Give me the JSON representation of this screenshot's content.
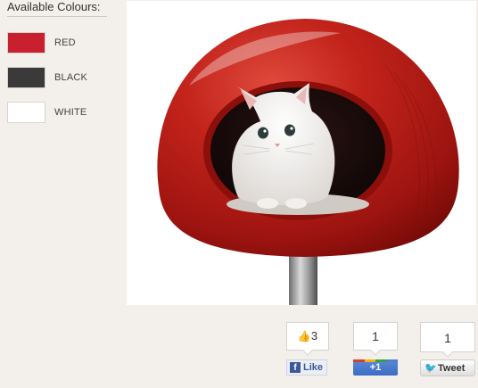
{
  "colours": {
    "title": "Available Colours:",
    "items": [
      {
        "label": "RED",
        "color": "#c8202e"
      },
      {
        "label": "BLACK",
        "color": "#3a3a3a"
      },
      {
        "label": "WHITE",
        "color": "#ffffff"
      }
    ]
  },
  "product_image": {
    "alt_icon": "cat-in-red-pod-bed-photo"
  },
  "share": {
    "facebook": {
      "count": "3",
      "button_label": "Like"
    },
    "google_plus": {
      "count": "1",
      "button_label": "+1"
    },
    "twitter": {
      "count": "1",
      "button_label": "Tweet"
    }
  }
}
